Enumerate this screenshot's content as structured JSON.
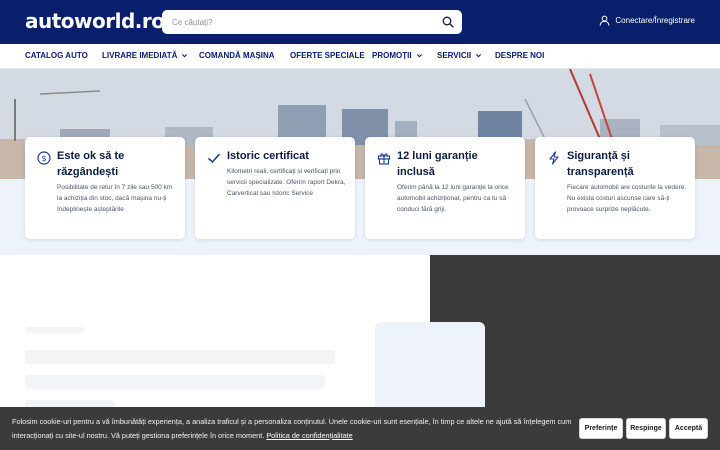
{
  "header": {
    "logo": "autoworld.ro",
    "search_placeholder": "Ce căutați?",
    "account_label": "Conectare/Înregistrare"
  },
  "nav": {
    "items": [
      {
        "label": "CATALOG AUTO",
        "dropdown": false
      },
      {
        "label": "LIVRARE IMEDIATĂ",
        "dropdown": true
      },
      {
        "label": "COMANDĂ MAȘINA",
        "dropdown": false
      },
      {
        "label": "OFERTE SPECIALE",
        "dropdown": false
      },
      {
        "label": "PROMOȚII",
        "dropdown": true
      },
      {
        "label": "SERVICII",
        "dropdown": true
      },
      {
        "label": "DESPRE NOI",
        "dropdown": false
      }
    ]
  },
  "features": [
    {
      "icon": "dollar-circle-icon",
      "title": "Este ok să te răzgândești",
      "text": "Posibilitate de retur în 7 zile sau 500 km la achiziția din stoc, dacă mașina nu-ți îndeplinește așteptările"
    },
    {
      "icon": "check-icon",
      "title": "Istoric certificat",
      "text": "Kilometri reali, certificați și verificați prin servicii specializate. Oferim raport Dekra, Carvertical sau Istoric Service"
    },
    {
      "icon": "gift-icon",
      "title": "12 luni garanție inclusă",
      "text": "Oferim până la 12 luni garanție la orice automobil achiziționat, pentru ca tu să conduci fără griji."
    },
    {
      "icon": "lightning-icon",
      "title": "Siguranță și transparență",
      "text": "Fiecare automobil are costurile la vedere. Nu exista costuri ascunse care să-ți provoace surprize neplăcute."
    }
  ],
  "cookie": {
    "text": "Folosim cookie-uri pentru a vă îmbunătăți experiența, a analiza traficul și a personaliza conținutul. Unele cookie-uri sunt esențiale, în timp ce altele ne ajută să înțelegem cum interacționați cu site-ul nostru. Vă puteți gestiona preferințele în orice moment.",
    "link": "Politica de confidențialitate",
    "buttons": {
      "preferences": "Preferințe",
      "reject": "Respinge",
      "accept": "Acceptă"
    }
  },
  "colors": {
    "header_bg": "#0a1f6b",
    "nav_text": "#0b1b6b",
    "accent": "#1e3a8a",
    "cookie_bg": "#3b3b3b"
  }
}
